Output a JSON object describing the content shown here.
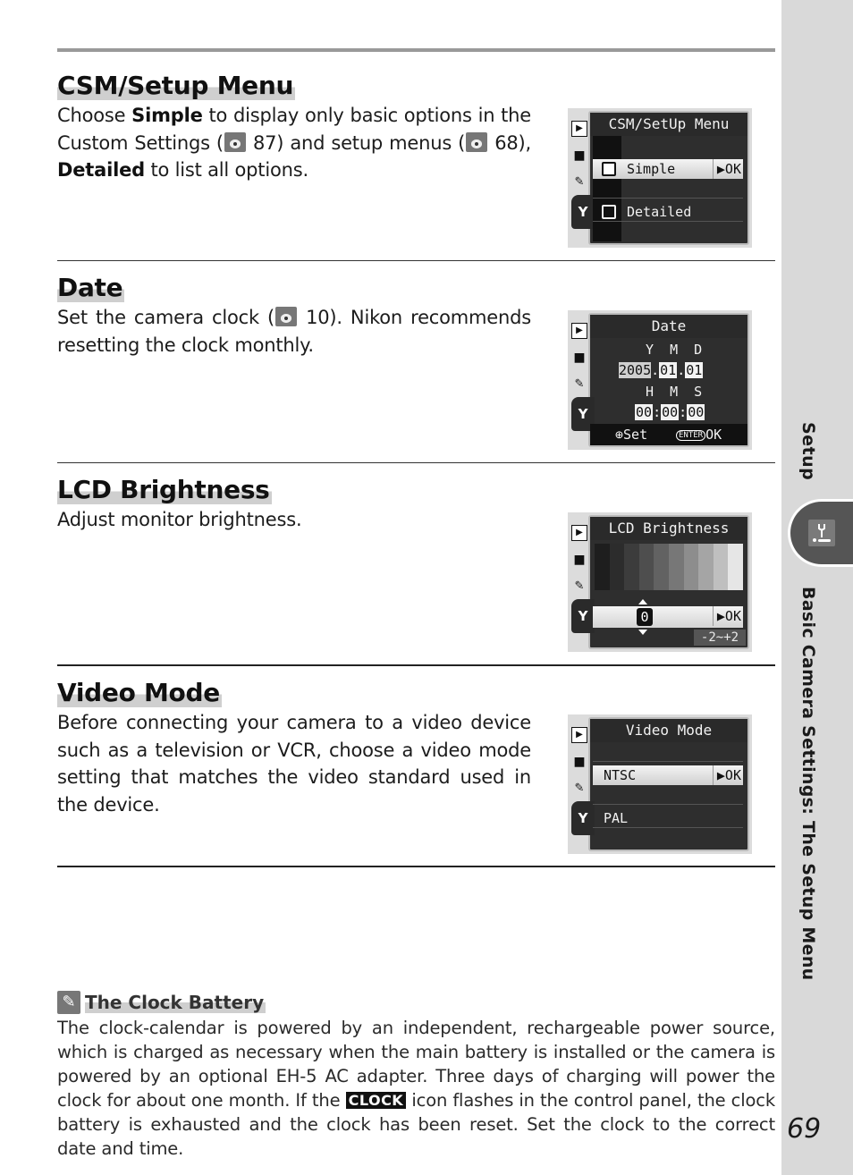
{
  "sidebar": {
    "section_label": "Setup",
    "chapter_title": "Basic Camera Settings: The Setup Menu",
    "tab_icon": "wrench-setup-icon"
  },
  "page_number": "69",
  "sections": [
    {
      "title": "CSM/Setup Menu",
      "body": [
        {
          "t": "Choose "
        },
        {
          "b": "Simple"
        },
        {
          "t": " to display only basic options in the Custom Settings ("
        },
        {
          "ref": "87"
        },
        {
          "t": ") and setup menus ("
        },
        {
          "ref": "68"
        },
        {
          "t": "), "
        },
        {
          "b": "Detailed"
        },
        {
          "t": " to list all options."
        }
      ],
      "screen": {
        "title": "CSM/SetUp Menu",
        "rows": [
          {
            "label": "Simple",
            "selected": true,
            "ok": "▶OK"
          },
          {
            "label": "Detailed",
            "selected": false
          }
        ]
      }
    },
    {
      "title": "Date",
      "body": [
        {
          "t": "Set the camera clock ("
        },
        {
          "ref": "10"
        },
        {
          "t": ").  Nikon recommends resetting the clock monthly."
        }
      ],
      "screen": {
        "title": "Date",
        "date_header": "Y  M  D",
        "year": "2005",
        "month": "01",
        "day": "01",
        "time_header": "H  M  S",
        "hour": "00",
        "minute": "00",
        "second": "00",
        "footer_set": "Set",
        "footer_enter": "ENTER",
        "footer_ok": "OK"
      }
    },
    {
      "title": "LCD Brightness",
      "body": [
        {
          "t": "Adjust monitor brightness."
        }
      ],
      "screen": {
        "title": "LCD Brightness",
        "grayscale_steps": [
          "#1e1e1e",
          "#2c2c2c",
          "#3c3c3c",
          "#4e4e4e",
          "#626262",
          "#777777",
          "#8d8d8d",
          "#a5a5a5",
          "#bfbfbf",
          "#e6e6e6"
        ],
        "value": "0",
        "ok": "▶OK",
        "range": "-2~+2"
      }
    },
    {
      "title": "Video Mode",
      "body": [
        {
          "t": "Before connecting your camera to a video device such as a television or VCR, choose a video mode setting that matches the video standard used in the device."
        }
      ],
      "screen": {
        "title": "Video Mode",
        "rows": [
          {
            "label": "NTSC",
            "selected": true,
            "ok": "▶OK"
          },
          {
            "label": "PAL",
            "selected": false
          }
        ]
      }
    }
  ],
  "note": {
    "icon": "pencil-note-icon",
    "title": "The Clock Battery",
    "body_before": "The clock-calendar is powered by an independent, rechargeable power source, which is charged as necessary when the main battery is installed or the camera is powered by an optional EH-5 AC adapter.  Three days of charging will power the clock for about one month.  If the ",
    "badge": "CLOCK",
    "body_after": " icon flashes in the control panel, the clock battery is exhausted and the clock has been reset.  Set the clock to the correct date and time."
  },
  "camera_side_icons": [
    "playback-icon",
    "shooting-icon",
    "custom-settings-pencil-icon",
    "setup-wrench-icon"
  ]
}
